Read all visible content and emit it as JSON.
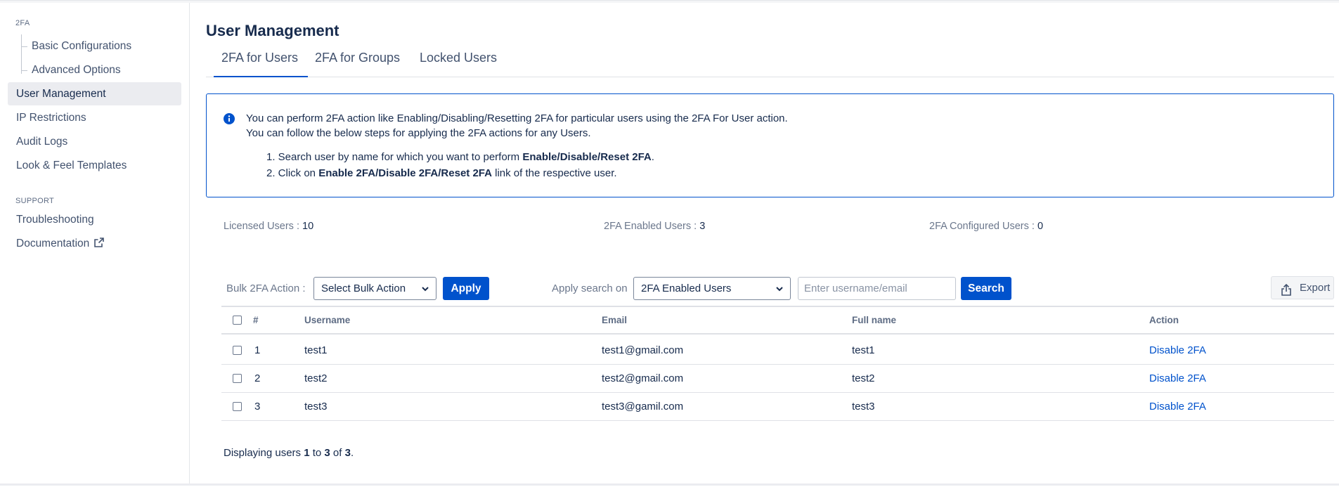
{
  "sidebar": {
    "section_2fa": "2FA",
    "basic_configurations": "Basic Configurations",
    "advanced_options": "Advanced Options",
    "user_management": "User Management",
    "ip_restrictions": "IP Restrictions",
    "audit_logs": "Audit Logs",
    "look_feel_templates": "Look & Feel Templates",
    "section_support": "SUPPORT",
    "troubleshooting": "Troubleshooting",
    "documentation": "Documentation"
  },
  "page": {
    "title": "User Management",
    "tabs": [
      "2FA for Users",
      "2FA for Groups",
      "Locked Users"
    ],
    "active_tab": "2FA for Users"
  },
  "info": {
    "line1": "You can perform 2FA action like Enabling/Disabling/Resetting 2FA for particular users using the 2FA For User action.",
    "line2": "You can follow the below steps for applying the 2FA actions for any Users.",
    "step1_prefix": "1. Search user by name for which you want to perform ",
    "step1_bold": "Enable/Disable/Reset 2FA",
    "step1_suffix": ".",
    "step2_prefix": "2. Click on ",
    "step2_bold": "Enable 2FA/Disable 2FA/Reset 2FA",
    "step2_suffix": " link of the respective user."
  },
  "stats": {
    "licensed_label": "Licensed Users : ",
    "licensed_value": "10",
    "enabled_label": "2FA Enabled Users : ",
    "enabled_value": "3",
    "configured_label": "2FA Configured Users : ",
    "configured_value": "0"
  },
  "toolbar": {
    "bulk_label": "Bulk 2FA Action :",
    "bulk_selected": "Select Bulk Action",
    "apply_label": "Apply",
    "search_on_label": "Apply search on",
    "search_on_selected": "2FA Enabled Users",
    "search_placeholder": "Enter username/email",
    "search_label": "Search",
    "export_label": "Export"
  },
  "table": {
    "headers": [
      "#",
      "Username",
      "Email",
      "Full name",
      "Action"
    ],
    "rows": [
      {
        "num": "1",
        "username": "test1",
        "email": "test1@gmail.com",
        "fullname": "test1",
        "action": "Disable 2FA"
      },
      {
        "num": "2",
        "username": "test2",
        "email": "test2@gmail.com",
        "fullname": "test2",
        "action": "Disable 2FA"
      },
      {
        "num": "3",
        "username": "test3",
        "email": "test3@gamil.com",
        "fullname": "test3",
        "action": "Disable 2FA"
      }
    ]
  },
  "footer": {
    "prefix": "Displaying users ",
    "from": "1",
    "to_word": " to ",
    "to": "3",
    "of_word": " of ",
    "total": "3",
    "suffix": "."
  },
  "colors": {
    "primary": "#0052cc",
    "text": "#172b4d",
    "muted": "#6b778c"
  }
}
